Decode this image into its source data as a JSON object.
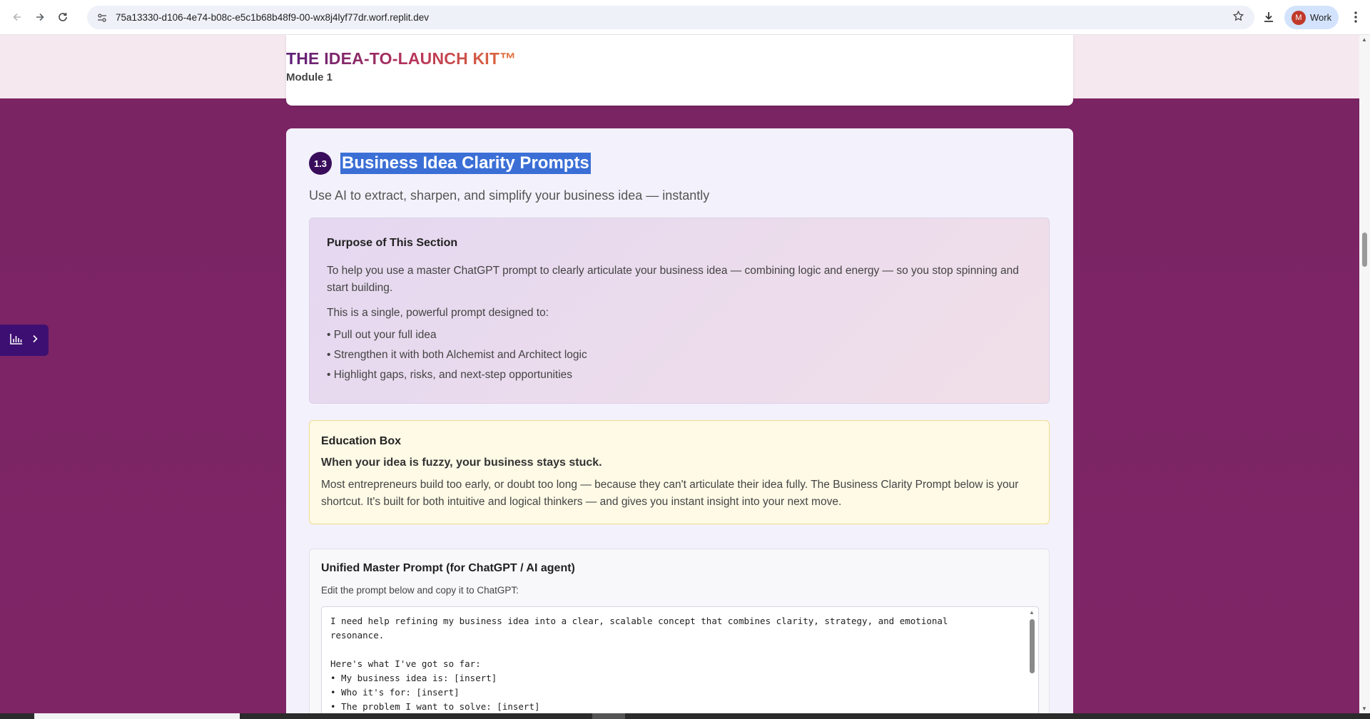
{
  "browser": {
    "url": "75a13330-d106-4e74-b08c-e5c1b68b48f9-00-wx8j4lyf77dr.worf.replit.dev",
    "profile_initial": "M",
    "profile_name": "Work"
  },
  "header": {
    "kit_title": "THE IDEA-TO-LAUNCH KIT™",
    "module": "Module 1"
  },
  "section": {
    "number": "1.3",
    "title": "Business Idea Clarity Prompts",
    "subtitle": "Use AI to extract, sharpen, and simplify your business idea — instantly"
  },
  "purpose": {
    "heading": "Purpose of This Section",
    "paragraph": "To help you use a master ChatGPT prompt to clearly articulate your business idea — combining logic and energy — so you stop spinning and start building.",
    "intro": "This is a single, powerful prompt designed to:",
    "bullets": [
      "• Pull out your full idea",
      "• Strengthen it with both Alchemist and Architect logic",
      "• Highlight gaps, risks, and next-step opportunities"
    ]
  },
  "education": {
    "heading": "Education Box",
    "bold": "When your idea is fuzzy, your business stays stuck.",
    "text": "Most entrepreneurs build too early, or doubt too long — because they can't articulate their idea fully. The Business Clarity Prompt below is your shortcut. It's built for both intuitive and logical thinkers — and gives you instant insight into your next move."
  },
  "prompt": {
    "heading": "Unified Master Prompt (for ChatGPT / AI agent)",
    "hint": "Edit the prompt below and copy it to ChatGPT:",
    "text": "I need help refining my business idea into a clear, scalable concept that combines clarity, strategy, and emotional\nresonance.\n\nHere's what I've got so far:\n• My business idea is: [insert]\n• Who it's for: [insert]\n• The problem I want to solve: [insert]"
  },
  "icons": {
    "back": "back-arrow-icon",
    "forward": "forward-arrow-icon",
    "reload": "reload-icon",
    "site_info": "site-info-icon",
    "star": "star-icon",
    "download": "download-icon",
    "menu": "kebab-menu-icon",
    "chart": "bar-chart-icon",
    "chevron": "chevron-right-icon"
  },
  "colors": {
    "page_bg": "#7a2464",
    "badge": "#3a0d5c",
    "selection": "#3b6fd6",
    "side_tab": "#3d0f72"
  }
}
